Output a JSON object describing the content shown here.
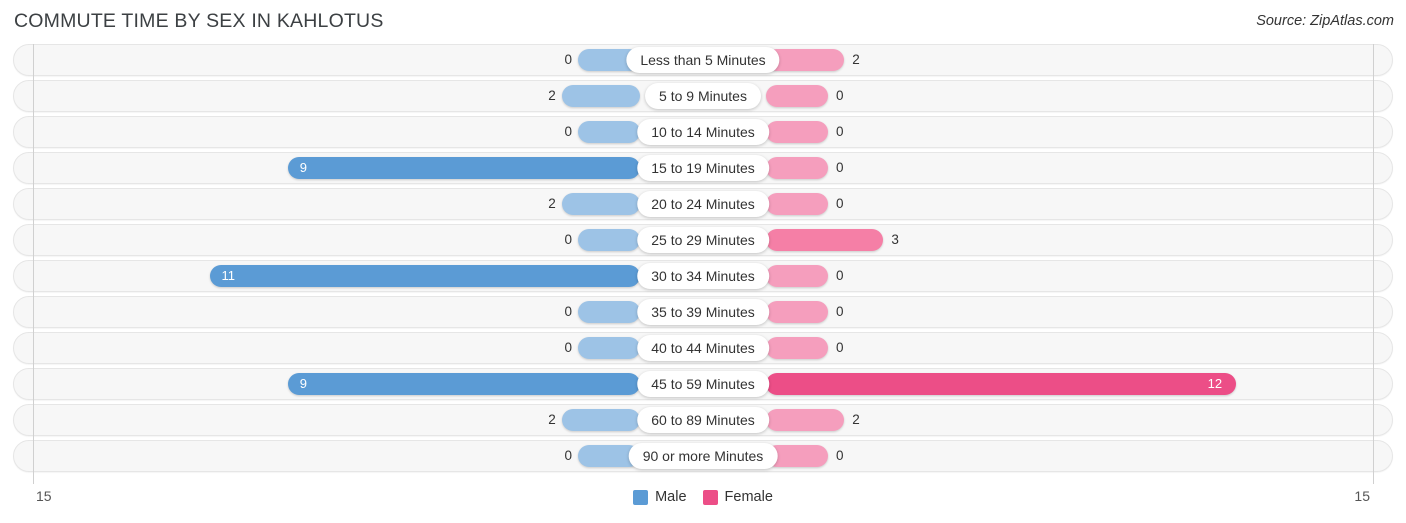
{
  "header": {
    "title": "COMMUTE TIME BY SEX IN KAHLOTUS",
    "source": "Source: ZipAtlas.com"
  },
  "legend": {
    "items": [
      {
        "label": "Male",
        "color": "#5b9bd5"
      },
      {
        "label": "Female",
        "color": "#ec4e87"
      }
    ]
  },
  "axis": {
    "left_end": "15",
    "right_end": "15",
    "max": 15
  },
  "chart_data": {
    "type": "bar",
    "orientation": "horizontal-diverging",
    "title": "COMMUTE TIME BY SEX IN KAHLOTUS",
    "xlabel": "",
    "ylabel": "",
    "axis_max": 15,
    "grid": false,
    "legend_position": "bottom-center",
    "categories": [
      "Less than 5 Minutes",
      "5 to 9 Minutes",
      "10 to 14 Minutes",
      "15 to 19 Minutes",
      "20 to 24 Minutes",
      "25 to 29 Minutes",
      "30 to 34 Minutes",
      "35 to 39 Minutes",
      "40 to 44 Minutes",
      "45 to 59 Minutes",
      "60 to 89 Minutes",
      "90 or more Minutes"
    ],
    "series": [
      {
        "name": "Male",
        "values": [
          0,
          2,
          0,
          9,
          2,
          0,
          11,
          0,
          0,
          9,
          2,
          0
        ]
      },
      {
        "name": "Female",
        "values": [
          2,
          0,
          0,
          0,
          0,
          3,
          0,
          0,
          0,
          12,
          2,
          0
        ]
      }
    ],
    "male_labels": [
      "0",
      "2",
      "0",
      "9",
      "2",
      "0",
      "11",
      "0",
      "0",
      "9",
      "2",
      "0"
    ],
    "female_labels": [
      "2",
      "0",
      "0",
      "0",
      "0",
      "3",
      "0",
      "0",
      "0",
      "12",
      "2",
      "0"
    ]
  }
}
